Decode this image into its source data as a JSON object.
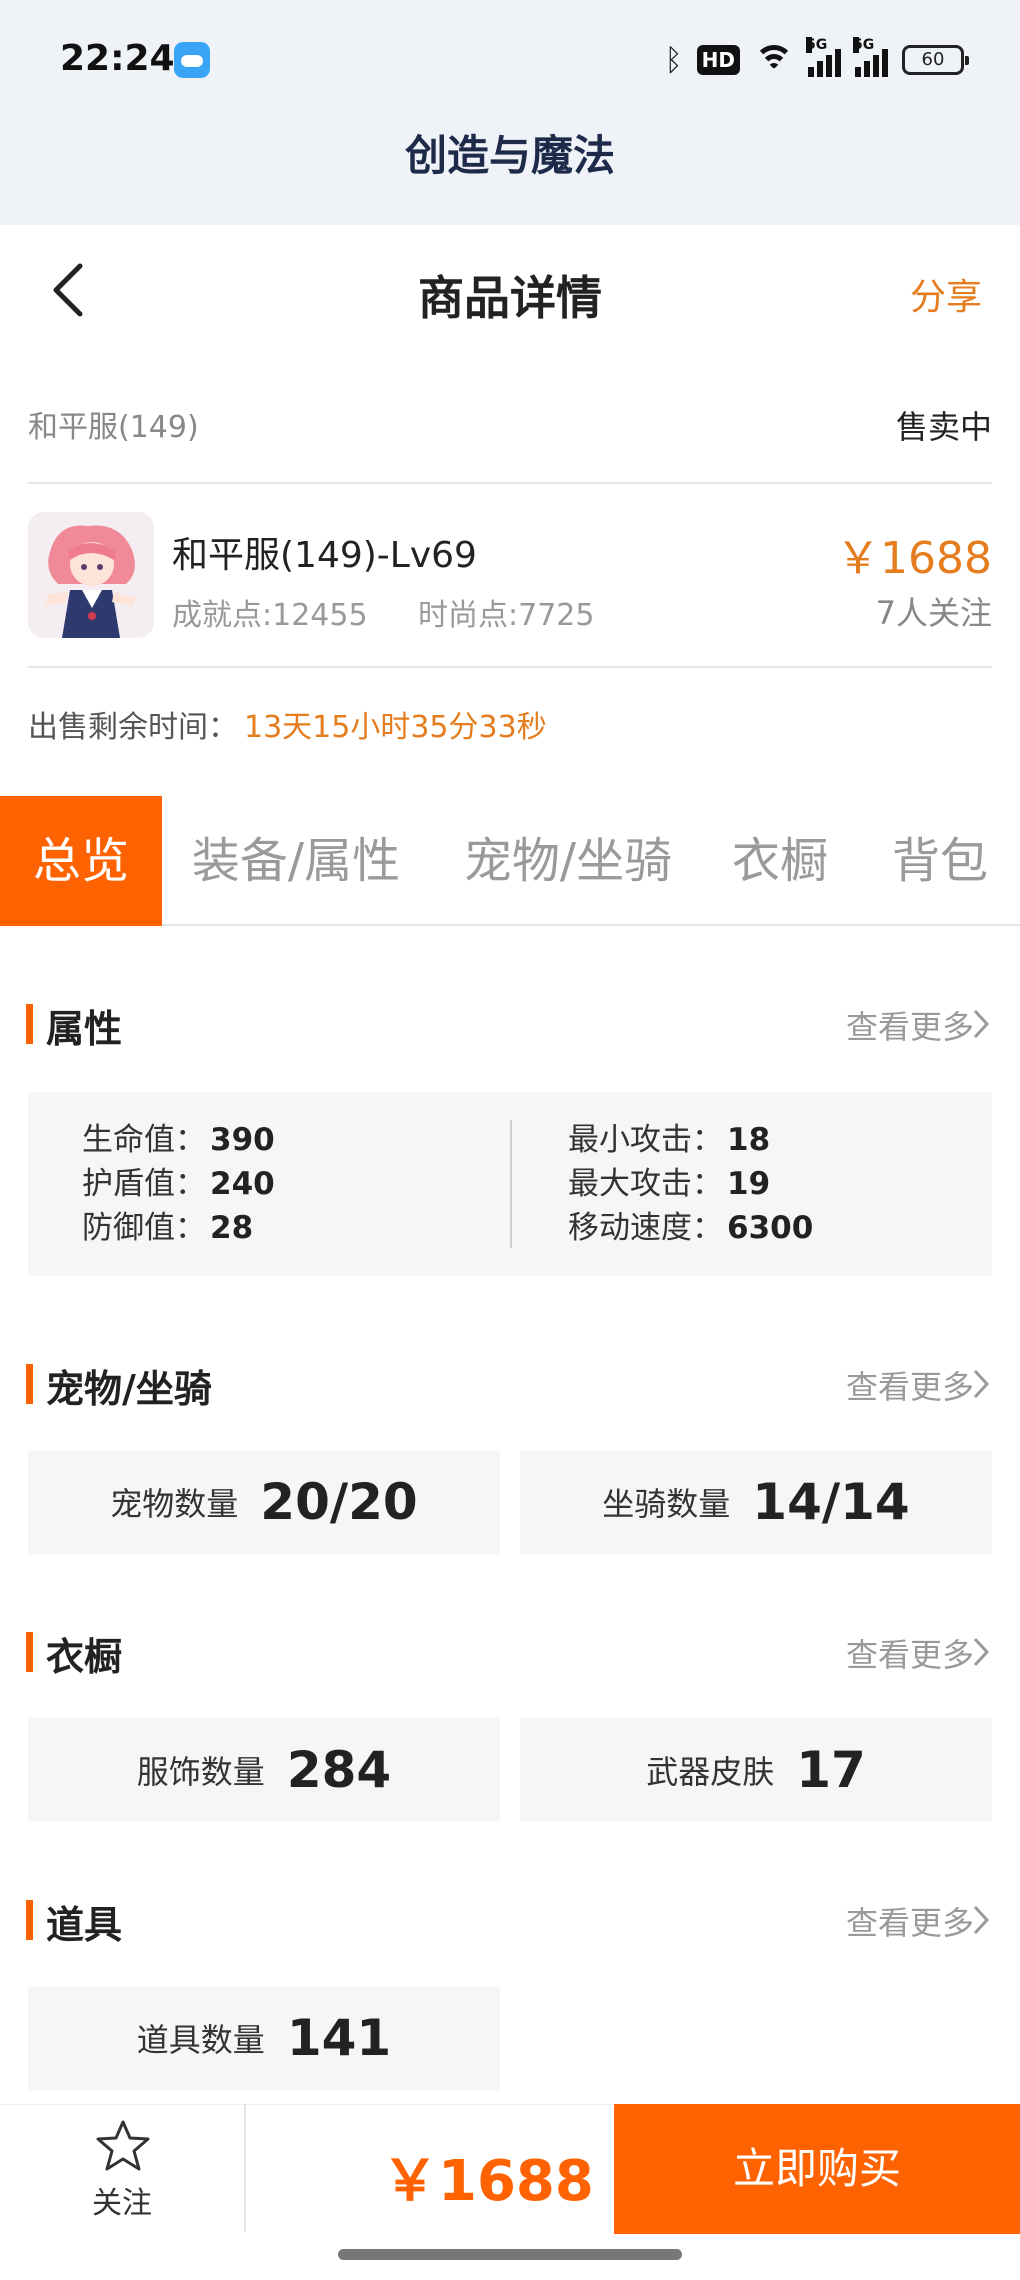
{
  "status": {
    "time": "22:24",
    "hd_label": "HD",
    "net_label": "5G",
    "battery": "60"
  },
  "app": {
    "title": "创造与魔法",
    "close_icon": "close-icon"
  },
  "nav": {
    "title": "商品详情",
    "share": "分享",
    "back_icon": "back-chevron-icon"
  },
  "listing": {
    "server": "和平服(149)",
    "status": "售卖中",
    "name": "和平服(149)-Lv69",
    "achievement": "成就点:12455",
    "fashion": "时尚点:7725",
    "price": "￥1688",
    "followers": "7人关注",
    "remaining_label": "出售剩余时间：",
    "remaining_value": "13天15小时35分33秒"
  },
  "tabs": [
    "总览",
    "装备/属性",
    "宠物/坐骑",
    "衣橱",
    "背包"
  ],
  "sections": {
    "attributes": {
      "title": "属性",
      "more": "查看更多",
      "left": [
        {
          "label": "生命值：",
          "value": "390"
        },
        {
          "label": "护盾值：",
          "value": "240"
        },
        {
          "label": "防御值：",
          "value": "28"
        }
      ],
      "right": [
        {
          "label": "最小攻击：",
          "value": "18"
        },
        {
          "label": "最大攻击：",
          "value": "19"
        },
        {
          "label": "移动速度：",
          "value": "6300"
        }
      ]
    },
    "pets": {
      "title": "宠物/坐骑",
      "more": "查看更多",
      "cards": [
        {
          "label": "宠物数量",
          "value": "20/20"
        },
        {
          "label": "坐骑数量",
          "value": "14/14"
        }
      ]
    },
    "wardrobe": {
      "title": "衣橱",
      "more": "查看更多",
      "cards": [
        {
          "label": "服饰数量",
          "value": "284"
        },
        {
          "label": "武器皮肤",
          "value": "17"
        }
      ]
    },
    "items": {
      "title": "道具",
      "more": "查看更多",
      "cards": [
        {
          "label": "道具数量",
          "value": "141"
        }
      ]
    }
  },
  "bottom": {
    "follow": "关注",
    "price": "￥1688",
    "buy": "立即购买"
  },
  "colors": {
    "accent": "#ff6200",
    "price": "#e57d1e",
    "header_bg": "#eff2f6"
  }
}
